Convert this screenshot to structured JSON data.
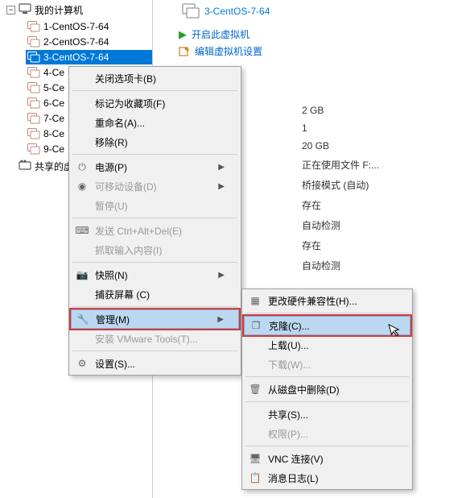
{
  "tree": {
    "root_label": "我的计算机",
    "items": [
      {
        "label": "1-CentOS-7-64"
      },
      {
        "label": "2-CentOS-7-64"
      },
      {
        "label": "3-CentOS-7-64",
        "selected": true
      },
      {
        "label": "4-Ce"
      },
      {
        "label": "5-Ce"
      },
      {
        "label": "6-Ce"
      },
      {
        "label": "7-Ce"
      },
      {
        "label": "8-Ce"
      },
      {
        "label": "9-Ce"
      }
    ],
    "shared_label": "共享的虚"
  },
  "detail": {
    "title": "3-CentOS-7-64",
    "action_power": "开启此虚拟机",
    "action_edit": "编辑虚拟机设置"
  },
  "specs": [
    "2 GB",
    "1",
    "20 GB",
    "正在使用文件 F:...",
    "桥接模式 (自动)",
    "存在",
    "自动检测",
    "存在",
    "自动检测"
  ],
  "ctx_menu1": {
    "close_tab": "关闭选项卡(B)",
    "favorite": "标记为收藏项(F)",
    "rename": "重命名(A)...",
    "remove": "移除(R)",
    "power": "电源(P)",
    "removable": "可移动设备(D)",
    "pause": "暂停(U)",
    "send_cad": "发送 Ctrl+Alt+Del(E)",
    "grab_input": "抓取输入内容(I)",
    "snapshot": "快照(N)",
    "capture": "捕获屏幕 (C)",
    "manage": "管理(M)",
    "vmtools": "安装 VMware Tools(T)...",
    "settings": "设置(S)..."
  },
  "ctx_menu2": {
    "hw_compat": "更改硬件兼容性(H)...",
    "clone": "克隆(C)...",
    "upload": "上载(U)...",
    "download": "下载(W)...",
    "delete_disk": "从磁盘中删除(D)",
    "share": "共享(S)...",
    "permission": "权限(P)...",
    "vnc": "VNC 连接(V)",
    "msglog": "消息日志(L)"
  }
}
